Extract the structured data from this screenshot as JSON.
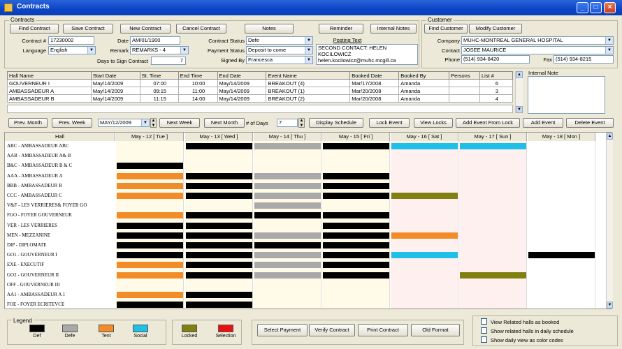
{
  "window": {
    "title": "Contracts"
  },
  "contracts_panel": {
    "legend": "Contracts",
    "buttons": {
      "find": "Find Contract",
      "save": "Save Contract",
      "new": "New Contract",
      "cancel": "Cancel Contract",
      "notes": "Notes",
      "reminder": "Reminder",
      "internal_notes": "Internal Notes"
    },
    "contract_no_label": "Contract #",
    "contract_no": "17230002",
    "date_label": "Date",
    "date": "AM/01/1900",
    "language_label": "Language",
    "language": "English",
    "remark_label": "Remark",
    "remark": "REMARKS - 4",
    "days_to_sign_label": "Days to Sign Contract",
    "days_to_sign": "7",
    "contract_status_label": "Contract Status",
    "contract_status": "Defe",
    "payment_status_label": "Payment Status",
    "payment_status": "Deposit to come",
    "signed_by_label": "Signed By",
    "signed_by": "Francesca",
    "posting_text_label": "Posting Text",
    "posting_text": "SECOND CONTACT: HELEN KOCILOWICZ helen.kocilowicz@muhc.mcgill.ca"
  },
  "customer_panel": {
    "legend": "Customer",
    "find_button": "Find Customer",
    "modify_button": "Modify Customer",
    "company_label": "Company",
    "company": "MUHC-MONTREAL GENERAL HOSPITAL",
    "contact_label": "Contact",
    "contact": "JOSEE MAURICE",
    "phone_label": "Phone",
    "phone": "(514) 934-8420",
    "fax_label": "Fax",
    "fax": "(514) 934-8215"
  },
  "halls_table": {
    "columns": [
      "Hall Name",
      "Start Date",
      "St. Time",
      "End Time",
      "End Date",
      "Event Name",
      "Booked Date",
      "Booked By",
      "Persons",
      "List #"
    ],
    "rows": [
      [
        "GOUVERNEUR I",
        "May/14/2009",
        "07:00",
        "10:00",
        "May/14/2009",
        "BREAKOUT (4)",
        "Mar/17/2008",
        "Amanda",
        "",
        "6"
      ],
      [
        "AMBASSADEUR A",
        "May/14/2009",
        "09:15",
        "11:00",
        "May/14/2009",
        "BREAKOUT (1)",
        "Mar/20/2008",
        "Amanda",
        "",
        "3"
      ],
      [
        "AMBASSADEUR B",
        "May/14/2009",
        "11:15",
        "14:00",
        "May/14/2009",
        "BREAKOUT (2)",
        "Mar/20/2008",
        "Amanda",
        "",
        "4"
      ]
    ]
  },
  "internal_note_label": "Internal Note",
  "nav": {
    "prev_month": "Prev. Month",
    "prev_week": "Prev. Week",
    "date": "MAY/12/2009",
    "next_week": "Next Week",
    "next_month": "Next Month",
    "days_label": "# of Days",
    "days": "7",
    "display_schedule": "Display Schedule",
    "lock_event": "Lock Event",
    "view_locks": "View Locks",
    "add_event_from_lock": "Add Event From Lock",
    "add_event": "Add Event",
    "delete_event": "Delete Event"
  },
  "schedule": {
    "hall_header": "Hall",
    "days": [
      "May - 12 [ Tue ]",
      "May - 13 [ Wed ]",
      "May - 14 [ Thu ]",
      "May - 15 [ Fri ]",
      "May - 16 [ Sat ]",
      "May - 17 [ Sun ]",
      "May - 18 [ Mon ]"
    ],
    "halls": [
      "ABC - AMBASSADEUR ABC",
      "AAB - AMBASSADEUR A& B",
      "B&C - AMBASSADEUR B & C",
      "AAA - AMBASSADEUR A",
      "BBB - AMBASSADEUR B",
      "CCC - AMBASSADEUR C",
      "V&F - LES VERRIERES& FOYER GO",
      "FGO - FOYER GOUVERNEUR",
      "VER - LES VERRIERES",
      "MEN - MEZZANINE",
      "DIP - DIPLOMATE",
      "GO1 - GOUVERNEUR I",
      "EXE - EXECUTIF",
      "GO2 - GOUVERNEUR II",
      "OFF - GOUVERNEUR III",
      "AA1 - AMBASSADEUR A 1",
      "FOE - FOYER ECRITEVCE"
    ],
    "colors": {
      "def": "#000000",
      "defe": "#a9a9a9",
      "tent": "#f28c28",
      "social": "#1ec0e8",
      "locked": "#808010",
      "selection": "#e81010"
    },
    "day_backgrounds": [
      "#fffbe8",
      "#fffbe8",
      "#fffbe8",
      "#fffbe8",
      "#fff0f0",
      "#fff0f0",
      "#ffffff"
    ],
    "cells": [
      [
        null,
        "def",
        "defe",
        "def",
        "social",
        "social",
        null
      ],
      [
        null,
        null,
        null,
        null,
        null,
        null,
        null
      ],
      [
        "def",
        null,
        null,
        null,
        null,
        null,
        null
      ],
      [
        "tent",
        "def",
        "defe",
        "def",
        null,
        null,
        null
      ],
      [
        "tent",
        "def",
        "defe",
        "def",
        null,
        null,
        null
      ],
      [
        "tent",
        "def",
        "defe",
        "def",
        "locked",
        null,
        null
      ],
      [
        null,
        null,
        "defe",
        null,
        null,
        null,
        null
      ],
      [
        "tent",
        "def",
        "def",
        "def",
        null,
        null,
        null
      ],
      [
        "def",
        "def",
        null,
        "def",
        null,
        null,
        null
      ],
      [
        "def",
        "def",
        "defe",
        "def",
        "tent",
        null,
        null
      ],
      [
        "def",
        "def",
        "def",
        "def",
        null,
        null,
        null
      ],
      [
        "def",
        "def",
        "defe",
        "def",
        "social",
        null,
        "def"
      ],
      [
        "tent",
        "def",
        "defe",
        "def",
        null,
        null,
        null
      ],
      [
        "tent",
        "def",
        "defe",
        "def",
        null,
        "locked",
        null
      ],
      [
        null,
        null,
        null,
        null,
        null,
        null,
        null
      ],
      [
        "tent",
        "def",
        null,
        null,
        null,
        null,
        null
      ],
      [
        "def",
        "def",
        null,
        null,
        null,
        null,
        null
      ]
    ]
  },
  "legend": {
    "title": "Legend",
    "items": [
      {
        "label": "Def",
        "color": "#000000"
      },
      {
        "label": "Defe",
        "color": "#a9a9a9"
      },
      {
        "label": "Tent",
        "color": "#f28c28"
      },
      {
        "label": "Social",
        "color": "#1ec0e8"
      }
    ],
    "extra": [
      {
        "label": "Locked",
        "color": "#808010"
      },
      {
        "label": "Selection",
        "color": "#e81010"
      }
    ]
  },
  "bottom_buttons": {
    "select_payment": "Select Payment",
    "verify_contract": "Verify Contract",
    "print_contract": "Print Contract",
    "old_format": "Old Format"
  },
  "options": {
    "view_related": "View Related halls as booked",
    "show_related_daily": "Show related halls in daily schedule",
    "show_daily_color": "Show daily view as color codes"
  }
}
